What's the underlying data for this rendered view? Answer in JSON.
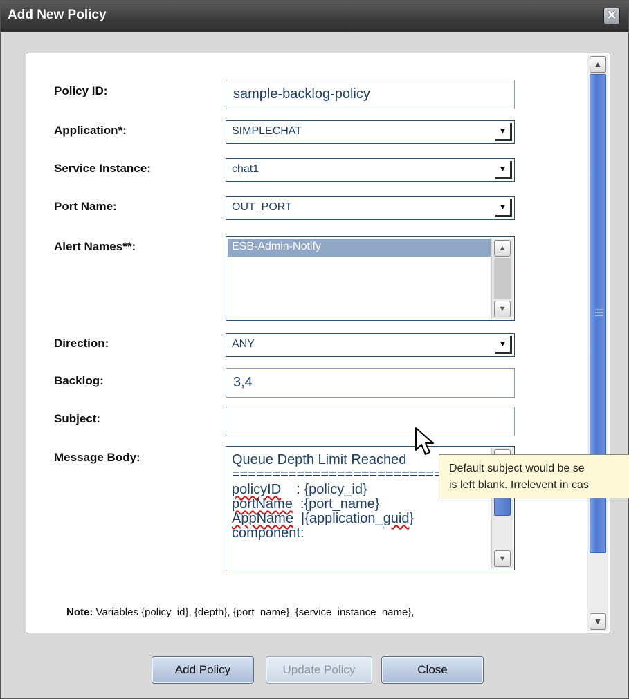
{
  "dialog": {
    "title": "Add New Policy",
    "close_glyph": "✕"
  },
  "form": {
    "policy_id": {
      "label": "Policy ID:",
      "value": "sample-backlog-policy"
    },
    "application": {
      "label": "Application*:",
      "value": "SIMPLECHAT"
    },
    "service_instance": {
      "label": "Service Instance:",
      "value": "chat1"
    },
    "port_name": {
      "label": "Port Name:",
      "value": "OUT_PORT"
    },
    "alert_names": {
      "label": "Alert Names**:",
      "items": [
        "ESB-Admin-Notify"
      ]
    },
    "direction": {
      "label": "Direction:",
      "value": "ANY"
    },
    "backlog": {
      "label": "Backlog:",
      "value": "3,4"
    },
    "subject": {
      "label": "Subject:",
      "value": ""
    },
    "message_body": {
      "label": "Message Body:",
      "line0": "Queue Depth Limit Reached",
      "line1": "==============================",
      "line2_key": "policyID",
      "line2_val": "    : {policy_id}",
      "line3_key": "portName",
      "line3_val": "  :{port_name}",
      "line4_key": "AppName",
      "line4_mid": "  |{application_",
      "line4_sq": "guid",
      "line4_end": "}",
      "line5": "component:"
    }
  },
  "note": {
    "prefix": "Note:",
    "text": " Variables {policy_id}, {depth}, {port_name}, {service_instance_name},"
  },
  "tooltip": {
    "line1": "Default subject would be se",
    "line2": "is left blank. Irrelevent in cas"
  },
  "buttons": {
    "add": "Add Policy",
    "update": "Update Policy",
    "close": "Close"
  },
  "colors": {
    "titlebar": "#3b3b3b",
    "input_text": "#1d3f66",
    "selection": "#91a5c4",
    "scroll_thumb": "#4f7bd0",
    "tooltip_bg": "#fdf9d9"
  }
}
